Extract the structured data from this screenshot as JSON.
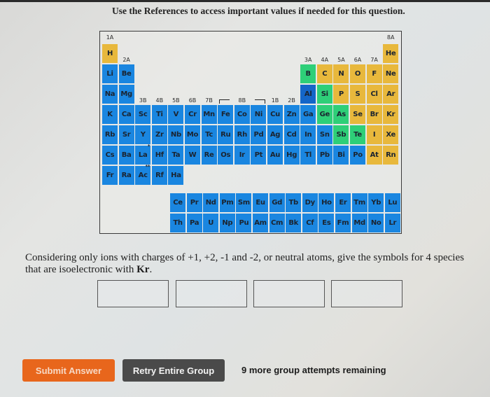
{
  "header": {
    "note": "Use the References to access important values if needed for this question."
  },
  "periodic_table": {
    "group_labels": {
      "g1": "1A",
      "g2": "2A",
      "g3": "3B",
      "g4": "4B",
      "g5": "5B",
      "g6": "6B",
      "g7": "7B",
      "g8": "8B",
      "g11": "1B",
      "g12": "2B",
      "g13": "3A",
      "g14": "4A",
      "g15": "5A",
      "g16": "6A",
      "g17": "7A",
      "g18": "8A"
    },
    "colors": {
      "blue": "#1a86e0",
      "dark_blue": "#1466c8",
      "green": "#2ecf78",
      "yellow": "#e8b83c"
    },
    "elements": [
      {
        "symbol": "H",
        "row": 1,
        "col": 1,
        "color": "yellow"
      },
      {
        "symbol": "He",
        "row": 1,
        "col": 18,
        "color": "yellow"
      },
      {
        "symbol": "Li",
        "row": 2,
        "col": 1,
        "color": "blue"
      },
      {
        "symbol": "Be",
        "row": 2,
        "col": 2,
        "color": "blue"
      },
      {
        "symbol": "B",
        "row": 2,
        "col": 13,
        "color": "green"
      },
      {
        "symbol": "C",
        "row": 2,
        "col": 14,
        "color": "yellow"
      },
      {
        "symbol": "N",
        "row": 2,
        "col": 15,
        "color": "yellow"
      },
      {
        "symbol": "O",
        "row": 2,
        "col": 16,
        "color": "yellow"
      },
      {
        "symbol": "F",
        "row": 2,
        "col": 17,
        "color": "yellow"
      },
      {
        "symbol": "Ne",
        "row": 2,
        "col": 18,
        "color": "yellow"
      },
      {
        "symbol": "Na",
        "row": 3,
        "col": 1,
        "color": "blue"
      },
      {
        "symbol": "Mg",
        "row": 3,
        "col": 2,
        "color": "blue"
      },
      {
        "symbol": "Al",
        "row": 3,
        "col": 13,
        "color": "dark_blue"
      },
      {
        "symbol": "Si",
        "row": 3,
        "col": 14,
        "color": "green"
      },
      {
        "symbol": "P",
        "row": 3,
        "col": 15,
        "color": "yellow"
      },
      {
        "symbol": "S",
        "row": 3,
        "col": 16,
        "color": "yellow"
      },
      {
        "symbol": "Cl",
        "row": 3,
        "col": 17,
        "color": "yellow"
      },
      {
        "symbol": "Ar",
        "row": 3,
        "col": 18,
        "color": "yellow"
      },
      {
        "symbol": "K",
        "row": 4,
        "col": 1,
        "color": "blue"
      },
      {
        "symbol": "Ca",
        "row": 4,
        "col": 2,
        "color": "blue"
      },
      {
        "symbol": "Sc",
        "row": 4,
        "col": 3,
        "color": "blue"
      },
      {
        "symbol": "Ti",
        "row": 4,
        "col": 4,
        "color": "blue"
      },
      {
        "symbol": "V",
        "row": 4,
        "col": 5,
        "color": "blue"
      },
      {
        "symbol": "Cr",
        "row": 4,
        "col": 6,
        "color": "blue"
      },
      {
        "symbol": "Mn",
        "row": 4,
        "col": 7,
        "color": "blue"
      },
      {
        "symbol": "Fe",
        "row": 4,
        "col": 8,
        "color": "blue"
      },
      {
        "symbol": "Co",
        "row": 4,
        "col": 9,
        "color": "blue"
      },
      {
        "symbol": "Ni",
        "row": 4,
        "col": 10,
        "color": "blue"
      },
      {
        "symbol": "Cu",
        "row": 4,
        "col": 11,
        "color": "blue"
      },
      {
        "symbol": "Zn",
        "row": 4,
        "col": 12,
        "color": "blue"
      },
      {
        "symbol": "Ga",
        "row": 4,
        "col": 13,
        "color": "blue"
      },
      {
        "symbol": "Ge",
        "row": 4,
        "col": 14,
        "color": "green"
      },
      {
        "symbol": "As",
        "row": 4,
        "col": 15,
        "color": "green"
      },
      {
        "symbol": "Se",
        "row": 4,
        "col": 16,
        "color": "yellow"
      },
      {
        "symbol": "Br",
        "row": 4,
        "col": 17,
        "color": "yellow"
      },
      {
        "symbol": "Kr",
        "row": 4,
        "col": 18,
        "color": "yellow"
      },
      {
        "symbol": "Rb",
        "row": 5,
        "col": 1,
        "color": "blue"
      },
      {
        "symbol": "Sr",
        "row": 5,
        "col": 2,
        "color": "blue"
      },
      {
        "symbol": "Y",
        "row": 5,
        "col": 3,
        "color": "blue"
      },
      {
        "symbol": "Zr",
        "row": 5,
        "col": 4,
        "color": "blue"
      },
      {
        "symbol": "Nb",
        "row": 5,
        "col": 5,
        "color": "blue"
      },
      {
        "symbol": "Mo",
        "row": 5,
        "col": 6,
        "color": "blue"
      },
      {
        "symbol": "Tc",
        "row": 5,
        "col": 7,
        "color": "blue"
      },
      {
        "symbol": "Ru",
        "row": 5,
        "col": 8,
        "color": "blue"
      },
      {
        "symbol": "Rh",
        "row": 5,
        "col": 9,
        "color": "blue"
      },
      {
        "symbol": "Pd",
        "row": 5,
        "col": 10,
        "color": "blue"
      },
      {
        "symbol": "Ag",
        "row": 5,
        "col": 11,
        "color": "blue"
      },
      {
        "symbol": "Cd",
        "row": 5,
        "col": 12,
        "color": "blue"
      },
      {
        "symbol": "In",
        "row": 5,
        "col": 13,
        "color": "blue"
      },
      {
        "symbol": "Sn",
        "row": 5,
        "col": 14,
        "color": "blue"
      },
      {
        "symbol": "Sb",
        "row": 5,
        "col": 15,
        "color": "green"
      },
      {
        "symbol": "Te",
        "row": 5,
        "col": 16,
        "color": "green"
      },
      {
        "symbol": "I",
        "row": 5,
        "col": 17,
        "color": "yellow"
      },
      {
        "symbol": "Xe",
        "row": 5,
        "col": 18,
        "color": "yellow"
      },
      {
        "symbol": "Cs",
        "row": 6,
        "col": 1,
        "color": "blue"
      },
      {
        "symbol": "Ba",
        "row": 6,
        "col": 2,
        "color": "blue"
      },
      {
        "symbol": "La",
        "row": 6,
        "col": 3,
        "color": "blue",
        "marker": "*"
      },
      {
        "symbol": "Hf",
        "row": 6,
        "col": 4,
        "color": "blue"
      },
      {
        "symbol": "Ta",
        "row": 6,
        "col": 5,
        "color": "blue"
      },
      {
        "symbol": "W",
        "row": 6,
        "col": 6,
        "color": "blue"
      },
      {
        "symbol": "Re",
        "row": 6,
        "col": 7,
        "color": "blue"
      },
      {
        "symbol": "Os",
        "row": 6,
        "col": 8,
        "color": "blue"
      },
      {
        "symbol": "Ir",
        "row": 6,
        "col": 9,
        "color": "blue"
      },
      {
        "symbol": "Pt",
        "row": 6,
        "col": 10,
        "color": "blue"
      },
      {
        "symbol": "Au",
        "row": 6,
        "col": 11,
        "color": "blue"
      },
      {
        "symbol": "Hg",
        "row": 6,
        "col": 12,
        "color": "blue"
      },
      {
        "symbol": "Tl",
        "row": 6,
        "col": 13,
        "color": "blue"
      },
      {
        "symbol": "Pb",
        "row": 6,
        "col": 14,
        "color": "blue"
      },
      {
        "symbol": "Bi",
        "row": 6,
        "col": 15,
        "color": "blue"
      },
      {
        "symbol": "Po",
        "row": 6,
        "col": 16,
        "color": "blue"
      },
      {
        "symbol": "At",
        "row": 6,
        "col": 17,
        "color": "yellow"
      },
      {
        "symbol": "Rn",
        "row": 6,
        "col": 18,
        "color": "yellow"
      },
      {
        "symbol": "Fr",
        "row": 7,
        "col": 1,
        "color": "blue"
      },
      {
        "symbol": "Ra",
        "row": 7,
        "col": 2,
        "color": "blue"
      },
      {
        "symbol": "Ac",
        "row": 7,
        "col": 3,
        "color": "blue",
        "marker": "**"
      },
      {
        "symbol": "Rf",
        "row": 7,
        "col": 4,
        "color": "blue"
      },
      {
        "symbol": "Ha",
        "row": 7,
        "col": 5,
        "color": "blue"
      }
    ],
    "lanthanides": [
      "Ce",
      "Pr",
      "Nd",
      "Pm",
      "Sm",
      "Eu",
      "Gd",
      "Tb",
      "Dy",
      "Ho",
      "Er",
      "Tm",
      "Yb",
      "Lu"
    ],
    "actinides": [
      "Th",
      "Pa",
      "U",
      "Np",
      "Pu",
      "Am",
      "Cm",
      "Bk",
      "Cf",
      "Es",
      "Fm",
      "Md",
      "No",
      "Lr"
    ]
  },
  "question": {
    "text_before": "Considering only ions with charges of +1, +2, -1 and -2, or neutral atoms, give the symbols for 4 species that are isoelectronic with ",
    "bold_term": "Kr",
    "text_after": ".",
    "answers": [
      "",
      "",
      "",
      ""
    ]
  },
  "actions": {
    "submit_label": "Submit Answer",
    "retry_label": "Retry Entire Group",
    "attempts_text": "9 more group attempts remaining"
  }
}
